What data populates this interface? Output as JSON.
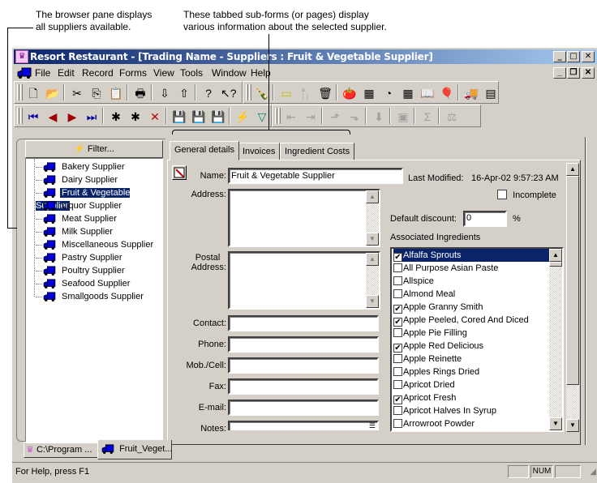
{
  "callouts": {
    "browser_pane": [
      "The browser pane displays",
      "all suppliers available."
    ],
    "tabbed_subforms": [
      "These tabbed sub-forms (or pages) display",
      "various information about the selected supplier."
    ]
  },
  "window": {
    "title": "Resort Restaurant - [Trading Name - Suppliers : Fruit & Vegetable Supplier]",
    "app_icon": "chef-hat-icon",
    "controls": {
      "minimize": "_",
      "maximize": "□",
      "close": "✕",
      "restore": "❐"
    }
  },
  "menu": {
    "items": [
      {
        "label": "File",
        "accel": "F"
      },
      {
        "label": "Edit",
        "accel": "E"
      },
      {
        "label": "Record",
        "accel": "R"
      },
      {
        "label": "Forms",
        "accel": "F"
      },
      {
        "label": "View",
        "accel": "V"
      },
      {
        "label": "Tools",
        "accel": "T"
      },
      {
        "label": "Window",
        "accel": "W"
      },
      {
        "label": "Help",
        "accel": "H"
      }
    ]
  },
  "toolbar1": {
    "buttons": [
      "new-icon",
      "open-icon",
      "cut-icon",
      "copy-icon",
      "paste-icon",
      "print-icon",
      "move-down-icon",
      "move-up-icon",
      "help-icon",
      "context-help-icon"
    ],
    "glyphs": [
      "🗋",
      "📂",
      "✂",
      "⎘",
      "📋",
      "🖶",
      "⇩",
      "⇧",
      "?",
      "↖?"
    ]
  },
  "toolbar2": {
    "buttons": [
      "recipe-icon",
      "menu-items-icon",
      "cutlery-icon",
      "measure-icon",
      "ingredient-icon",
      "ingredient-table-icon",
      "cost-icon",
      "price-table-icon",
      "book-icon",
      "balloons-icon",
      "supplier-icon",
      "report-icon"
    ],
    "glyphs": [
      "🍾",
      "▭",
      "🍴",
      "🗑",
      "🍅",
      "▦",
      "◔",
      "▦",
      "📖",
      "🎈",
      "🚚",
      "▤"
    ]
  },
  "toolbar3": {
    "buttons": [
      "first-record-icon",
      "prev-record-icon",
      "next-record-icon",
      "last-record-icon",
      "new-record-icon",
      "duplicate-record-icon",
      "delete-record-icon",
      "save-icon",
      "undo-save-icon",
      "save-copy-icon",
      "filter-lightning-icon",
      "filter-icon"
    ],
    "glyphs": [
      "⏮",
      "◀",
      "▶",
      "⏭",
      "✱",
      "✱",
      "✕",
      "💾",
      "💾",
      "💾",
      "⚡",
      "▽"
    ]
  },
  "toolbar4": {
    "buttons": [
      "link-left-icon",
      "link-right-icon",
      "export-up-icon",
      "export-down-icon",
      "import-icon",
      "layout-icon",
      "sum-icon",
      "balance-icon"
    ],
    "glyphs": [
      "⇤",
      "⇥",
      "⬏",
      "⬎",
      "⬇",
      "▣",
      "Σ",
      "⚖"
    ]
  },
  "browser": {
    "filter_label": "Filter...",
    "suppliers": [
      "Bakery Supplier",
      "Dairy Supplier",
      "Fruit & Vegetable Supplier",
      "Liquor Supplier",
      "Meat Supplier",
      "Milk Supplier",
      "Miscellaneous Supplier",
      "Pastry Supplier",
      "Poultry Supplier",
      "Seafood Supplier",
      "Smallgoods Supplier"
    ],
    "selected_index": 2
  },
  "tabs": [
    {
      "label": "General details",
      "active": true
    },
    {
      "label": "Invoices",
      "active": false
    },
    {
      "label": "Ingredient Costs",
      "active": false
    }
  ],
  "form": {
    "name_label": "Name:",
    "name_value": "Fruit & Vegetable Supplier",
    "last_modified_label": "Last Modified:",
    "last_modified_value": "16-Apr-02 9:57:23 AM",
    "address_label": "Address:",
    "postal_label_1": "Postal",
    "postal_label_2": "Address:",
    "contact_label": "Contact:",
    "phone_label": "Phone:",
    "mobile_label": "Mob./Cell:",
    "fax_label": "Fax:",
    "email_label": "E-mail:",
    "notes_label": "Notes:",
    "incomplete_label": "Incomplete",
    "incomplete_checked": false,
    "discount_label": "Default discount:",
    "discount_value": "0",
    "discount_unit": "%",
    "ingredients_label": "Associated Ingredients"
  },
  "ingredients": [
    {
      "name": "Alfalfa Sprouts",
      "checked": true
    },
    {
      "name": "All Purpose Asian Paste",
      "checked": false
    },
    {
      "name": "Allspice",
      "checked": false
    },
    {
      "name": "Almond Meal",
      "checked": false
    },
    {
      "name": "Apple Granny Smith",
      "checked": true
    },
    {
      "name": "Apple Peeled, Cored And Diced",
      "checked": true
    },
    {
      "name": "Apple Pie Filling",
      "checked": false
    },
    {
      "name": "Apple Red Delicious",
      "checked": true
    },
    {
      "name": "Apple Reinette",
      "checked": false
    },
    {
      "name": "Apples Rings Dried",
      "checked": false
    },
    {
      "name": "Apricot Dried",
      "checked": false
    },
    {
      "name": "Apricot Fresh",
      "checked": true
    },
    {
      "name": "Apricot Halves In Syrup",
      "checked": false
    },
    {
      "name": "Arrowroot Powder",
      "checked": false
    }
  ],
  "window_tabs": [
    {
      "label": "C:\\Program ...",
      "icon": "chef-hat-icon"
    },
    {
      "label": "Fruit_Veget...",
      "icon": "supplier-icon"
    }
  ],
  "status": {
    "help_text": "For Help, press F1",
    "num": "NUM"
  }
}
